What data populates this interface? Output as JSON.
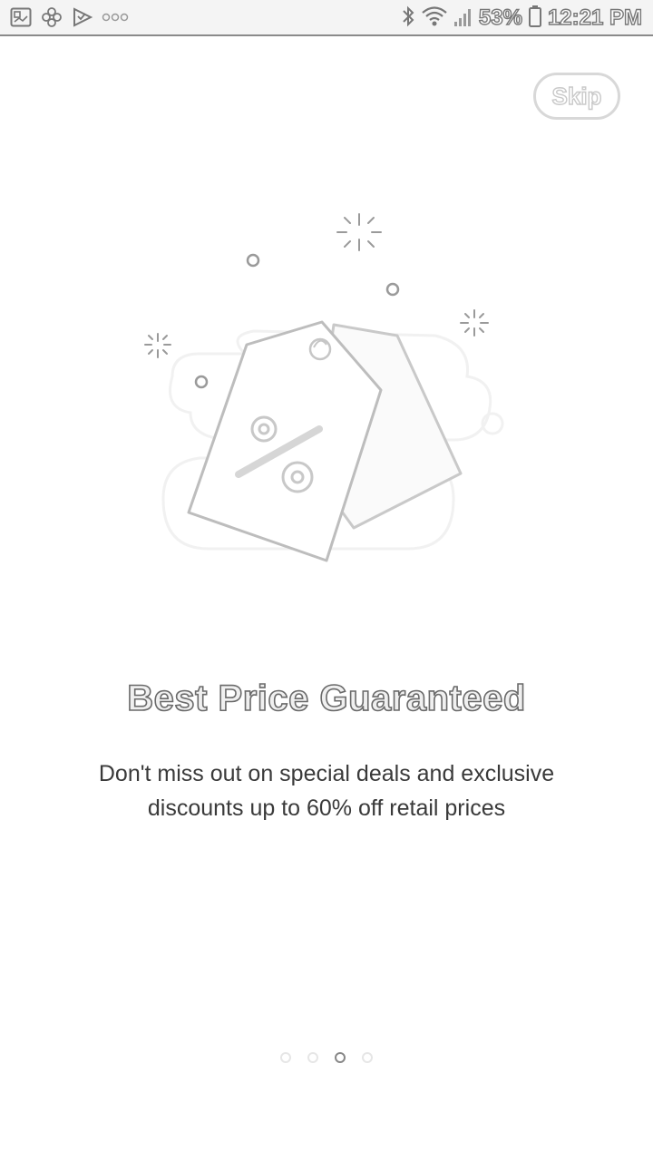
{
  "status_bar": {
    "battery": "53%",
    "time": "12:21 PM",
    "left_icons": [
      "gallery-icon",
      "pinwheel-icon",
      "checklist-icon",
      "more-dots-icon"
    ],
    "right_icons": [
      "bluetooth-icon",
      "wifi-icon",
      "signal-icon",
      "battery-icon"
    ]
  },
  "skip": {
    "label": "Skip"
  },
  "onboarding": {
    "illustration": "price-tags-icon",
    "title": "Best Price Guaranteed",
    "subtitle": "Don't miss out on special deals and exclusive discounts up to 60% off retail prices"
  },
  "pager": {
    "total": 4,
    "active_index": 2
  }
}
